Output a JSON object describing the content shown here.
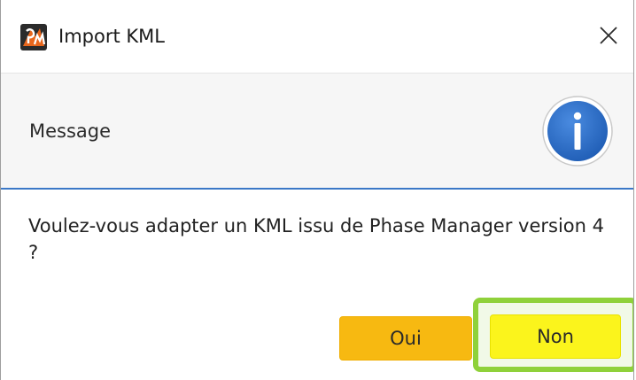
{
  "window": {
    "title": "Import KML",
    "app_icon": "phase-manager-app-icon",
    "close_icon": "close-icon"
  },
  "header": {
    "label": "Message",
    "icon": "info-icon",
    "icon_color": "#2c6fc6"
  },
  "body": {
    "message": "Voulez-vous adapter un KML issu de Phase Manager version 4 ?"
  },
  "buttons": {
    "yes_label": "Oui",
    "yes_color": "#f7b911",
    "no_label": "Non",
    "no_color": "#fbf41c",
    "highlight_color": "#8fd13a"
  },
  "accent_color": "#3b78c7"
}
